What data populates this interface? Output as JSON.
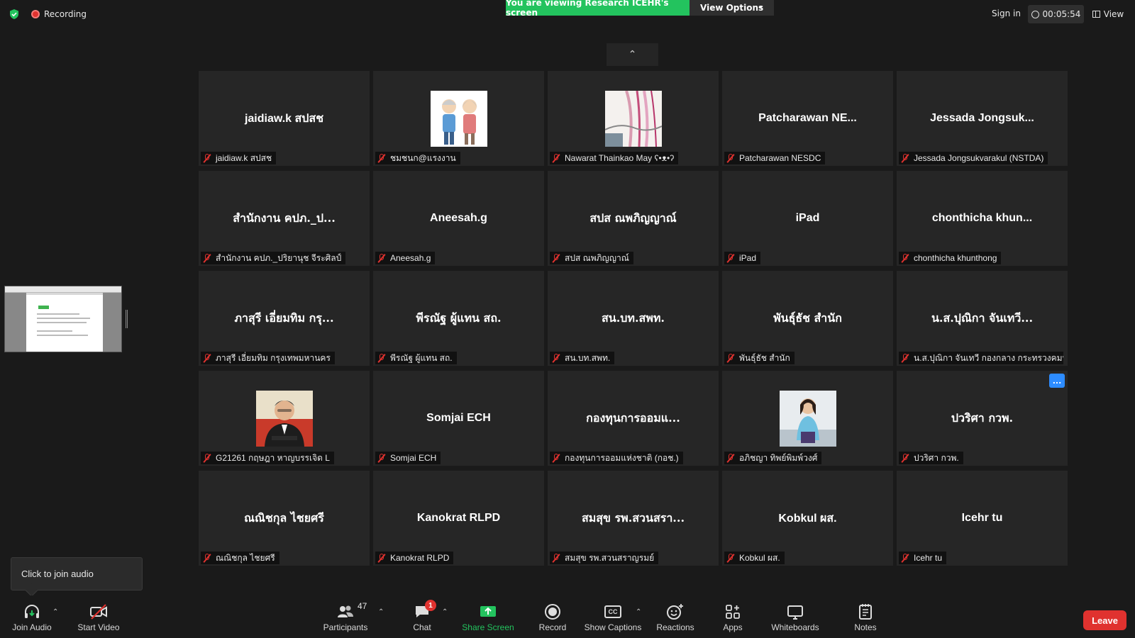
{
  "topbar": {
    "recording_label": "Recording",
    "viewing_banner": "You are viewing Research ICEHR's screen",
    "view_options_label": "View Options",
    "sign_in_label": "Sign in",
    "timer": "00:05:54",
    "view_label": "View"
  },
  "tooltip": {
    "text": "Click to join audio"
  },
  "tiles": [
    {
      "center": "jaidiaw.k สปสช",
      "label": "jaidiaw.k สปสช",
      "center_latin": true
    },
    {
      "center": "",
      "label": "ชมชนก@แรงงาน",
      "image": "elderly-couple-avatar"
    },
    {
      "center": "",
      "label": "Nawarat Thainkao May ʕ•ᴥ•ʔ",
      "image": "art-photo-avatar"
    },
    {
      "center": "Patcharawan NE...",
      "label": "Patcharawan NESDC",
      "center_latin": true
    },
    {
      "center": "Jessada Jongsuk...",
      "label": "Jessada Jongsukvarakul (NSTDA)",
      "center_latin": true
    },
    {
      "center": "สำนักงาน คปภ._ป...",
      "label": "สำนักงาน คปภ._ปริยานุช จีระศิลป์"
    },
    {
      "center": "Aneesah.g",
      "label": "Aneesah.g",
      "center_latin": true
    },
    {
      "center": "สปส ณพภิญญาณ์",
      "label": "สปส ณพภิญญาณ์"
    },
    {
      "center": "iPad",
      "label": "iPad",
      "center_latin": true
    },
    {
      "center": "chonthicha  khun...",
      "label": "chonthicha khunthong",
      "center_latin": true
    },
    {
      "center": "ภาสุรี เอี่ยมทิม กรุ...",
      "label": "ภาสุรี เอี่ยมทิม กรุงเทพมหานคร"
    },
    {
      "center": "พีรณัฐ ผู้แทน สถ.",
      "label": "พีรณัฐ ผู้แทน สถ."
    },
    {
      "center": "สน.บท.สพท.",
      "label": "สน.บท.สพท."
    },
    {
      "center": "พันธุ์ธัช สำนัก",
      "label": "พันธุ์ธัช สำนัก"
    },
    {
      "center": "น.ส.ปุณิกา จันเทวี...",
      "label": "น.ส.ปุณิกา จันเทวี กองกลาง กระทรวงคมน..."
    },
    {
      "center": "",
      "label": "G21261 กฤษฎา หาญบรรเจิด L",
      "image": "man-portrait-avatar"
    },
    {
      "center": "Somjai ECH",
      "label": "Somjai ECH",
      "center_latin": true
    },
    {
      "center": "กองทุนการออมแ...",
      "label": "กองทุนการออมแห่งชาติ (กอช.)"
    },
    {
      "center": "",
      "label": "อภิชญา ทิพย์พิมพ์วงศ์",
      "image": "woman-portrait-avatar"
    },
    {
      "center": "ปวริศา กวพ.",
      "label": "ปวริศา กวพ.",
      "more_button": "..."
    },
    {
      "center": "ณณิชกุล  ไชยศรี",
      "label": "ณณิชกุล ไชยศรี"
    },
    {
      "center": "Kanokrat RLPD",
      "label": "Kanokrat RLPD",
      "center_latin": true
    },
    {
      "center": "สมสุข รพ.สวนสรา...",
      "label": "สมสุข รพ.สวนสราญรมย์"
    },
    {
      "center": "Kobkul ผส.",
      "label": "Kobkul ผส.",
      "center_latin": true
    },
    {
      "center": "Icehr tu",
      "label": "Icehr tu",
      "center_latin": true
    }
  ],
  "toolbar": {
    "join_audio": "Join Audio",
    "start_video": "Start Video",
    "participants": "Participants",
    "participants_count": "47",
    "chat": "Chat",
    "chat_badge": "1",
    "share_screen": "Share Screen",
    "record": "Record",
    "show_captions": "Show Captions",
    "captions_icon_text": "CC",
    "reactions": "Reactions",
    "apps": "Apps",
    "whiteboards": "Whiteboards",
    "notes": "Notes",
    "leave": "Leave"
  },
  "colors": {
    "background": "#1a1a1a",
    "tile": "#262626",
    "accent_green": "#23c35e",
    "muted_red": "#e0322f",
    "blue": "#2d8cff"
  }
}
